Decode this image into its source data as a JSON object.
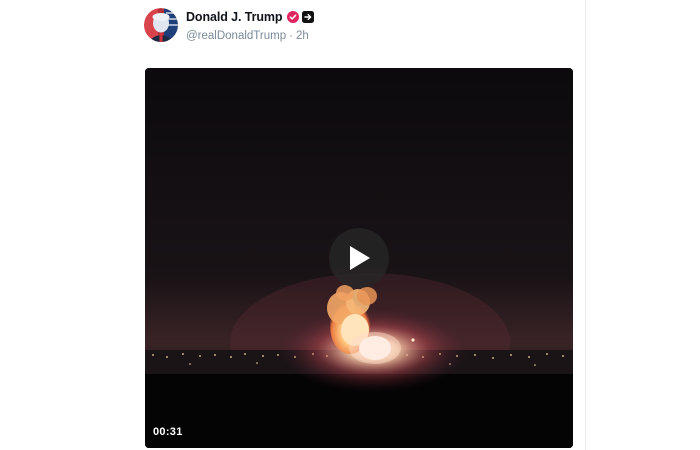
{
  "post": {
    "author": {
      "display_name": "Donald J. Trump",
      "handle": "@realDonaldTrump",
      "time_ago": "2h",
      "separator": "·"
    },
    "icons": {
      "avatar": "avatar-portrait",
      "verified": "verified-badge-icon",
      "follow": "follow-arrow-icon"
    },
    "colors": {
      "verified": "#e0245e",
      "follow": "#111111"
    },
    "video": {
      "duration": "00:31",
      "play_icon": "play-icon"
    }
  }
}
